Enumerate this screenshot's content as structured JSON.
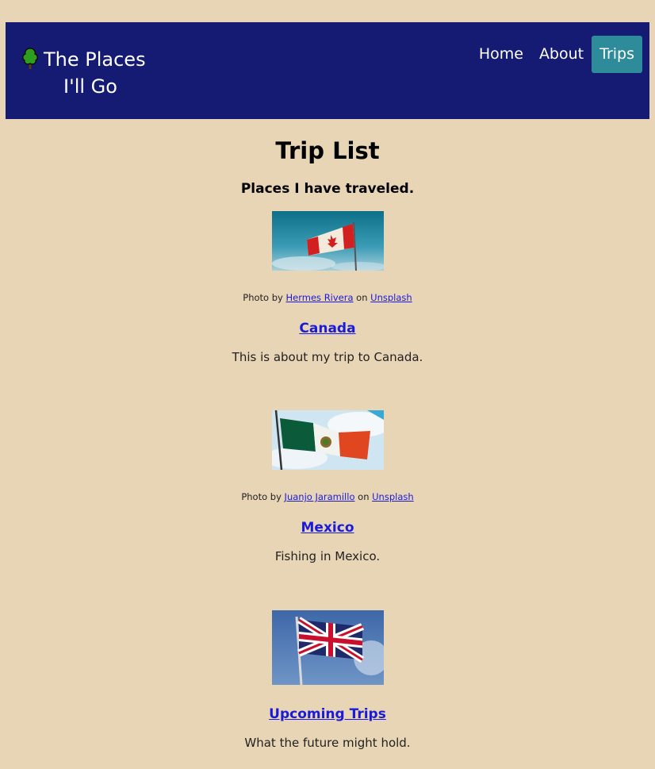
{
  "brand": {
    "line1": "The Places",
    "line2": "I'll Go",
    "icon": "tree-icon"
  },
  "nav": [
    {
      "label": "Home",
      "active": false
    },
    {
      "label": "About",
      "active": false
    },
    {
      "label": "Trips",
      "active": true
    }
  ],
  "page": {
    "title": "Trip List",
    "subtitle": "Places I have traveled."
  },
  "trips": [
    {
      "flag": "canada-flag",
      "credit_prefix": "Photo by ",
      "photographer": "Hermes Rivera",
      "credit_mid": " on ",
      "source": "Unsplash",
      "title": "Canada",
      "description": "This is about my trip to Canada."
    },
    {
      "flag": "mexico-flag",
      "credit_prefix": "Photo by ",
      "photographer": "Juanjo Jaramillo",
      "credit_mid": " on ",
      "source": "Unsplash",
      "title": "Mexico",
      "description": "Fishing in Mexico."
    },
    {
      "flag": "uk-flag",
      "title": "Upcoming Trips",
      "description": "What the future might hold."
    }
  ],
  "colors": {
    "background": "#e8d5b5",
    "header": "#151a73",
    "active_nav": "#2e8b9a",
    "link": "#1a1adb"
  }
}
